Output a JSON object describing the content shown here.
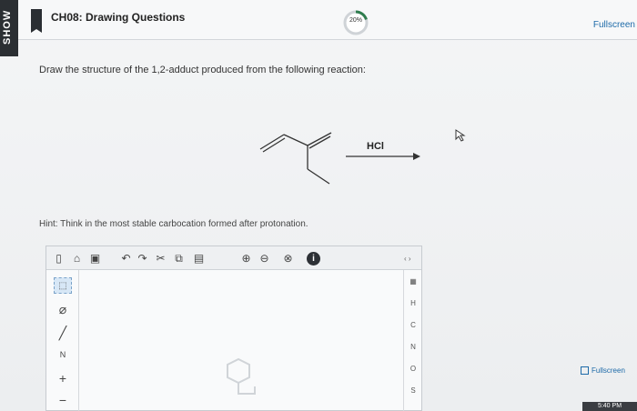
{
  "side_strip": {
    "label": "SHOW"
  },
  "header": {
    "title": "CH08: Drawing Questions",
    "progress_label": "20%",
    "progress_fraction": 0.2,
    "fullscreen_label": "Fullscreen"
  },
  "question": {
    "prompt": "Draw the structure of the 1,2-adduct produced from the following reaction:",
    "reagent": "HCl",
    "hint": "Hint: Think in the most stable carbocation formed after protonation."
  },
  "editor": {
    "toolbar_icons": [
      "new-file-icon",
      "open-folder-icon",
      "save-icon",
      "undo-icon",
      "redo-icon",
      "cut-icon",
      "copy-icon",
      "paste-icon",
      "zoom-in-icon",
      "zoom-out-icon",
      "zoom-reset-icon",
      "info-icon"
    ],
    "left_tools": [
      "select-icon",
      "eraser-icon",
      "bond-icon",
      "charge-label",
      "plus-icon",
      "minus-icon"
    ],
    "charge_label": "N",
    "plus_label": "+",
    "minus_label": "−",
    "atoms": [
      "H",
      "C",
      "N",
      "O",
      "S"
    ],
    "expand_label": "‹ ›"
  },
  "footer": {
    "fullscreen_label": "Fullscreen",
    "time": "5:40 PM"
  },
  "colors": {
    "link": "#1d6aa8",
    "dark": "#2b2f33"
  }
}
